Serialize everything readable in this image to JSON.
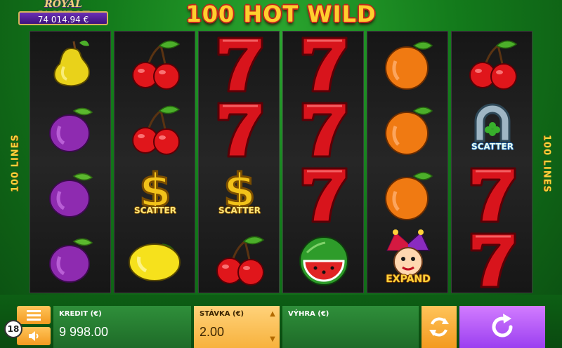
{
  "jackpot": {
    "title": "ROYAL JACKPOT",
    "amount": "74 014.94 €"
  },
  "game_title": "100 HOT WILD",
  "side_lines": {
    "left": "100 LINES",
    "right": "100 LINES"
  },
  "reels": [
    [
      "pear",
      "plum",
      "plum",
      "plum"
    ],
    [
      "cherry",
      "cherry",
      "dollar-scatter",
      "lemon"
    ],
    [
      "seven",
      "seven",
      "dollar-scatter",
      "cherry"
    ],
    [
      "seven",
      "seven",
      "seven",
      "watermelon"
    ],
    [
      "orange",
      "orange",
      "orange",
      "joker-expand"
    ],
    [
      "cherry",
      "horseshoe-scatter",
      "seven",
      "seven"
    ]
  ],
  "symbol_labels": {
    "scatter": "SCATTER",
    "expand": "EXPAND"
  },
  "bottom": {
    "credit_label": "KREDIT (€)",
    "credit_value": "9 998.00",
    "stake_label": "STÁVKA (€)",
    "stake_value": "2.00",
    "win_label": "VÝHRA (€)",
    "win_value": "",
    "age_badge": "18"
  },
  "colors": {
    "stake_panel": "#f7b23e",
    "spin_button": "#b056f5",
    "panel_green": "#2f8f3a"
  }
}
